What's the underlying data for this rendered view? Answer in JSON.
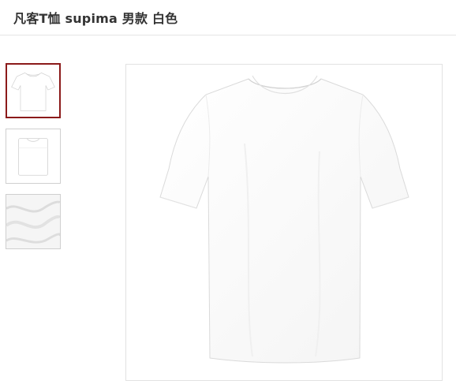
{
  "product": {
    "title": "凡客T恤 supima 男款 白色"
  },
  "gallery": {
    "selected_index": 0,
    "thumbnails": [
      {
        "icon": "tshirt-front-icon"
      },
      {
        "icon": "tshirt-folded-icon"
      },
      {
        "icon": "fabric-texture-icon"
      }
    ],
    "main_image": {
      "icon": "tshirt-front-icon"
    }
  },
  "colors": {
    "selected_border": "#8b1a1a",
    "thumb_border": "#cfcfcf",
    "title_text": "#333333"
  }
}
